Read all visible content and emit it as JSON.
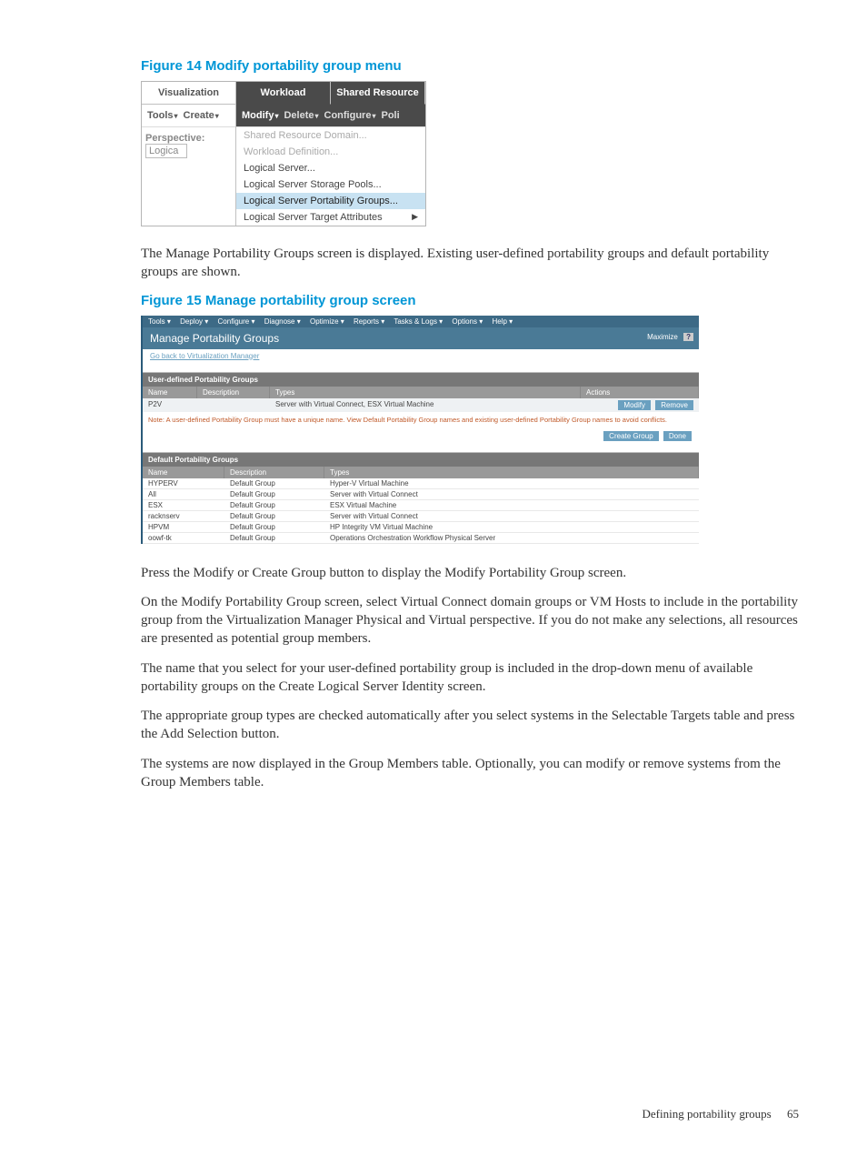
{
  "figure14": {
    "title": "Figure 14 Modify portability group menu",
    "tabs": [
      "Visualization",
      "Workload",
      "Shared Resource"
    ],
    "left_toolbar": [
      "Tools",
      "Create"
    ],
    "right_toolbar": [
      "Modify",
      "Delete",
      "Configure",
      "Poli"
    ],
    "perspective_label": "Perspective:",
    "perspective_value": "Logica",
    "dropdown": [
      {
        "label": "Shared Resource Domain...",
        "state": "disabled"
      },
      {
        "label": "Workload Definition...",
        "state": "disabled"
      },
      {
        "label": "Logical Server...",
        "state": "normal"
      },
      {
        "label": "Logical Server Storage Pools...",
        "state": "normal"
      },
      {
        "label": "Logical Server Portability Groups...",
        "state": "highlight"
      },
      {
        "label": "Logical Server Target Attributes",
        "state": "normal",
        "submenu": true
      }
    ]
  },
  "para1": "The Manage Portability Groups screen is displayed. Existing user-defined portability groups and default portability groups are shown.",
  "figure15": {
    "title": "Figure 15 Manage portability group screen",
    "menubar": [
      "Tools ▾",
      "Deploy ▾",
      "Configure ▾",
      "Diagnose ▾",
      "Optimize ▾",
      "Reports ▾",
      "Tasks & Logs ▾",
      "Options ▾",
      "Help ▾"
    ],
    "page_title": "Manage Portability Groups",
    "maximize": "Maximize",
    "help_q": "?",
    "back_link": "Go back to Virtualization Manager",
    "user_section": "User-defined Portability Groups",
    "cols": {
      "name": "Name",
      "desc": "Description",
      "types": "Types",
      "actions": "Actions"
    },
    "user_rows": [
      {
        "name": "P2V",
        "desc": "",
        "types": "Server with Virtual Connect, ESX Virtual Machine"
      }
    ],
    "btn_modify": "Modify",
    "btn_remove": "Remove",
    "note": "Note: A user-defined Portability Group must have a unique name. View Default Portability Group names and existing user-defined Portability Group names to avoid conflicts.",
    "btn_create": "Create Group",
    "btn_done": "Done",
    "default_section": "Default Portability Groups",
    "default_rows": [
      {
        "name": "HYPERV",
        "desc": "Default Group",
        "types": "Hyper-V Virtual Machine"
      },
      {
        "name": "All",
        "desc": "Default Group",
        "types": "Server with Virtual Connect"
      },
      {
        "name": "ESX",
        "desc": "Default Group",
        "types": "ESX Virtual Machine"
      },
      {
        "name": "racknserv",
        "desc": "Default Group",
        "types": "Server with Virtual Connect"
      },
      {
        "name": "HPVM",
        "desc": "Default Group",
        "types": "HP Integrity VM Virtual Machine"
      },
      {
        "name": "oowf-tk",
        "desc": "Default Group",
        "types": "Operations Orchestration Workflow Physical Server"
      }
    ]
  },
  "para2": "Press the Modify or Create Group button to display the Modify Portability Group screen.",
  "para3": "On the Modify Portability Group screen, select Virtual Connect domain groups or VM Hosts to include in the portability group from the Virtualization Manager Physical and Virtual perspective. If you do not make any selections, all resources are presented as potential group members.",
  "para4": "The name that you select for your user-defined portability group is included in the drop-down menu of available portability groups on the Create Logical Server Identity screen.",
  "para5": "The appropriate group types are checked automatically after you select systems in the Selectable Targets table and press the Add Selection button.",
  "para6": "The systems are now displayed in the Group Members table. Optionally, you can modify or remove systems from the Group Members table.",
  "footer": {
    "section": "Defining portability groups",
    "page": "65"
  }
}
